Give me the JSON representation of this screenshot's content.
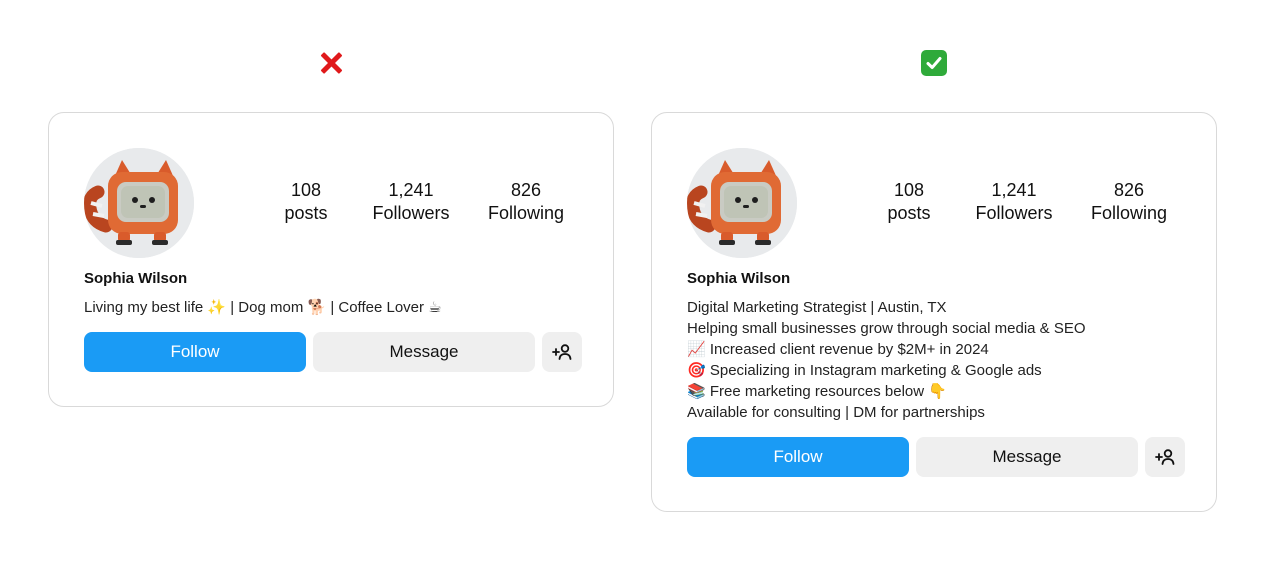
{
  "markers": {
    "bad_icon": "red-x-icon",
    "good_icon": "green-check-icon"
  },
  "colors": {
    "follow_button": "#1a9bf5",
    "secondary_button": "#efefef",
    "bad_mark": "#e0191b",
    "good_mark": "#2faa3a"
  },
  "bad_card": {
    "stats": [
      {
        "number": "108",
        "label": "posts"
      },
      {
        "number": "1,241",
        "label": "Followers"
      },
      {
        "number": "826",
        "label": "Following"
      }
    ],
    "name": "Sophia Wilson",
    "bio_lines": [
      "Living my best life ✨ | Dog mom 🐕 | Coffee Lover ☕"
    ],
    "follow_label": "Follow",
    "message_label": "Message"
  },
  "good_card": {
    "stats": [
      {
        "number": "108",
        "label": "posts"
      },
      {
        "number": "1,241",
        "label": "Followers"
      },
      {
        "number": "826",
        "label": "Following"
      }
    ],
    "name": "Sophia Wilson",
    "bio_lines": [
      "Digital Marketing Strategist | Austin, TX",
      "Helping small businesses grow through social media & SEO",
      "📈 Increased client revenue by $2M+ in 2024",
      "🎯 Specializing in Instagram marketing & Google ads",
      "📚 Free marketing resources below 👇",
      "Available for consulting | DM for partnerships"
    ],
    "follow_label": "Follow",
    "message_label": "Message"
  }
}
